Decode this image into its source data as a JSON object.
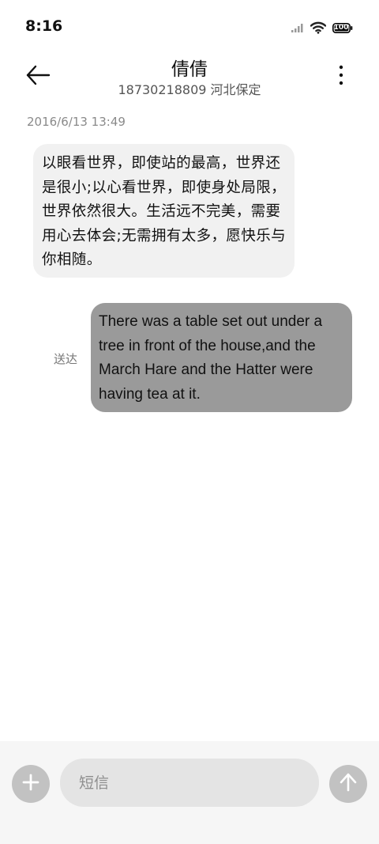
{
  "status_bar": {
    "time": "8:16",
    "battery_level": "100",
    "signal_icon": "signal-bars-icon",
    "wifi_icon": "wifi-icon"
  },
  "header": {
    "back_icon": "arrow-left-icon",
    "contact_name": "倩倩",
    "contact_subtitle": "18730218809 河北保定",
    "more_icon": "more-vertical-icon"
  },
  "conversation": {
    "timestamp": "2016/6/13 13:49",
    "incoming_message": "以眼看世界，即使站的最高，世界还是很小;以心看世界，即使身处局限，世界依然很大。生活远不完美，需要用心去体会;无需拥有太多，愿快乐与你相随。",
    "outgoing_message": "There was a table set out under a tree in front of the house,and the March Hare and the Hatter were having tea at it.",
    "outgoing_status": "送达"
  },
  "input_bar": {
    "add_icon": "plus-icon",
    "placeholder": "短信",
    "send_icon": "arrow-up-icon"
  },
  "colors": {
    "incoming_bubble": "#f1f1f1",
    "outgoing_bubble": "#9a9a9a",
    "input_bar_bg": "#f6f6f6",
    "round_button": "#c2c2c2"
  }
}
